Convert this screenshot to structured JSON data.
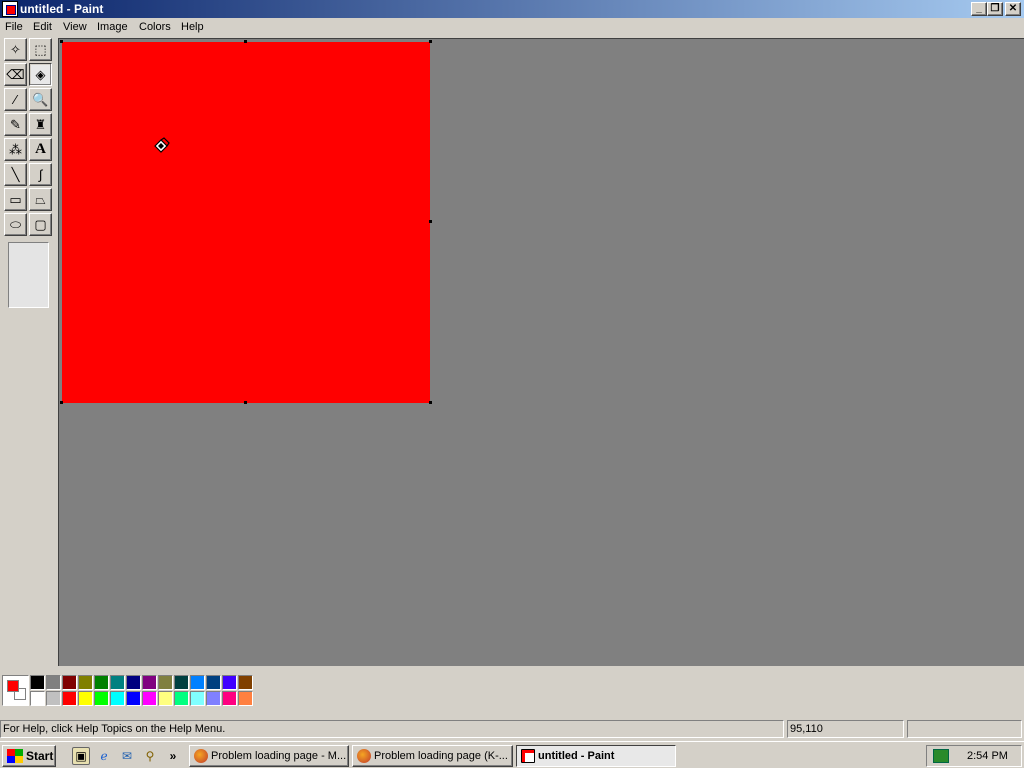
{
  "window": {
    "title": "untitled - Paint",
    "controls": {
      "minimize": "_",
      "maximize": "❐",
      "close": "✕"
    }
  },
  "menu": {
    "items": [
      "File",
      "Edit",
      "View",
      "Image",
      "Colors",
      "Help"
    ]
  },
  "toolbox": {
    "tools": [
      {
        "name": "free-form-select-icon",
        "glyph": "✧"
      },
      {
        "name": "select-icon",
        "glyph": "⬚"
      },
      {
        "name": "eraser-icon",
        "glyph": "⌫"
      },
      {
        "name": "fill-with-color-icon",
        "glyph": "◈"
      },
      {
        "name": "pick-color-icon",
        "glyph": "⁄"
      },
      {
        "name": "magnifier-icon",
        "glyph": "🔍"
      },
      {
        "name": "pencil-icon",
        "glyph": "✎"
      },
      {
        "name": "brush-icon",
        "glyph": "♜"
      },
      {
        "name": "airbrush-icon",
        "glyph": "⁂"
      },
      {
        "name": "text-icon",
        "glyph": "A"
      },
      {
        "name": "line-icon",
        "glyph": "╲"
      },
      {
        "name": "curve-icon",
        "glyph": "∫"
      },
      {
        "name": "rectangle-icon",
        "glyph": "▭"
      },
      {
        "name": "polygon-icon",
        "glyph": "⏢"
      },
      {
        "name": "ellipse-icon",
        "glyph": "⬭"
      },
      {
        "name": "rounded-rectangle-icon",
        "glyph": "▢"
      }
    ],
    "active_tool": "fill-with-color-icon"
  },
  "canvas": {
    "fill_color": "#ff0000"
  },
  "colors": {
    "foreground": "#ff0000",
    "background": "#ffffff",
    "palette_top": [
      "#000000",
      "#808080",
      "#800000",
      "#808000",
      "#008000",
      "#008080",
      "#000080",
      "#800080",
      "#808040",
      "#004040",
      "#0080ff",
      "#004080",
      "#4000ff",
      "#804000"
    ],
    "palette_bottom": [
      "#ffffff",
      "#c0c0c0",
      "#ff0000",
      "#ffff00",
      "#00ff00",
      "#00ffff",
      "#0000ff",
      "#ff00ff",
      "#ffff80",
      "#00ff80",
      "#80ffff",
      "#8080ff",
      "#ff0080",
      "#ff8040"
    ]
  },
  "status": {
    "help_text": "For Help, click Help Topics on the Help Menu.",
    "coords": "95,110",
    "size": ""
  },
  "taskbar": {
    "start_label": "Start",
    "quick_launch": [
      "show-desktop-icon",
      "internet-explorer-icon",
      "outlook-express-icon",
      "search-icon"
    ],
    "more": "»",
    "tasks": [
      {
        "label": "Problem loading page - M...",
        "icon": "firefox-icon",
        "active": false
      },
      {
        "label": "Problem loading page (K-...",
        "icon": "firefox-icon",
        "active": false
      },
      {
        "label": "untitled - Paint",
        "icon": "paint-icon",
        "active": true
      }
    ],
    "clock": "2:54 PM"
  }
}
